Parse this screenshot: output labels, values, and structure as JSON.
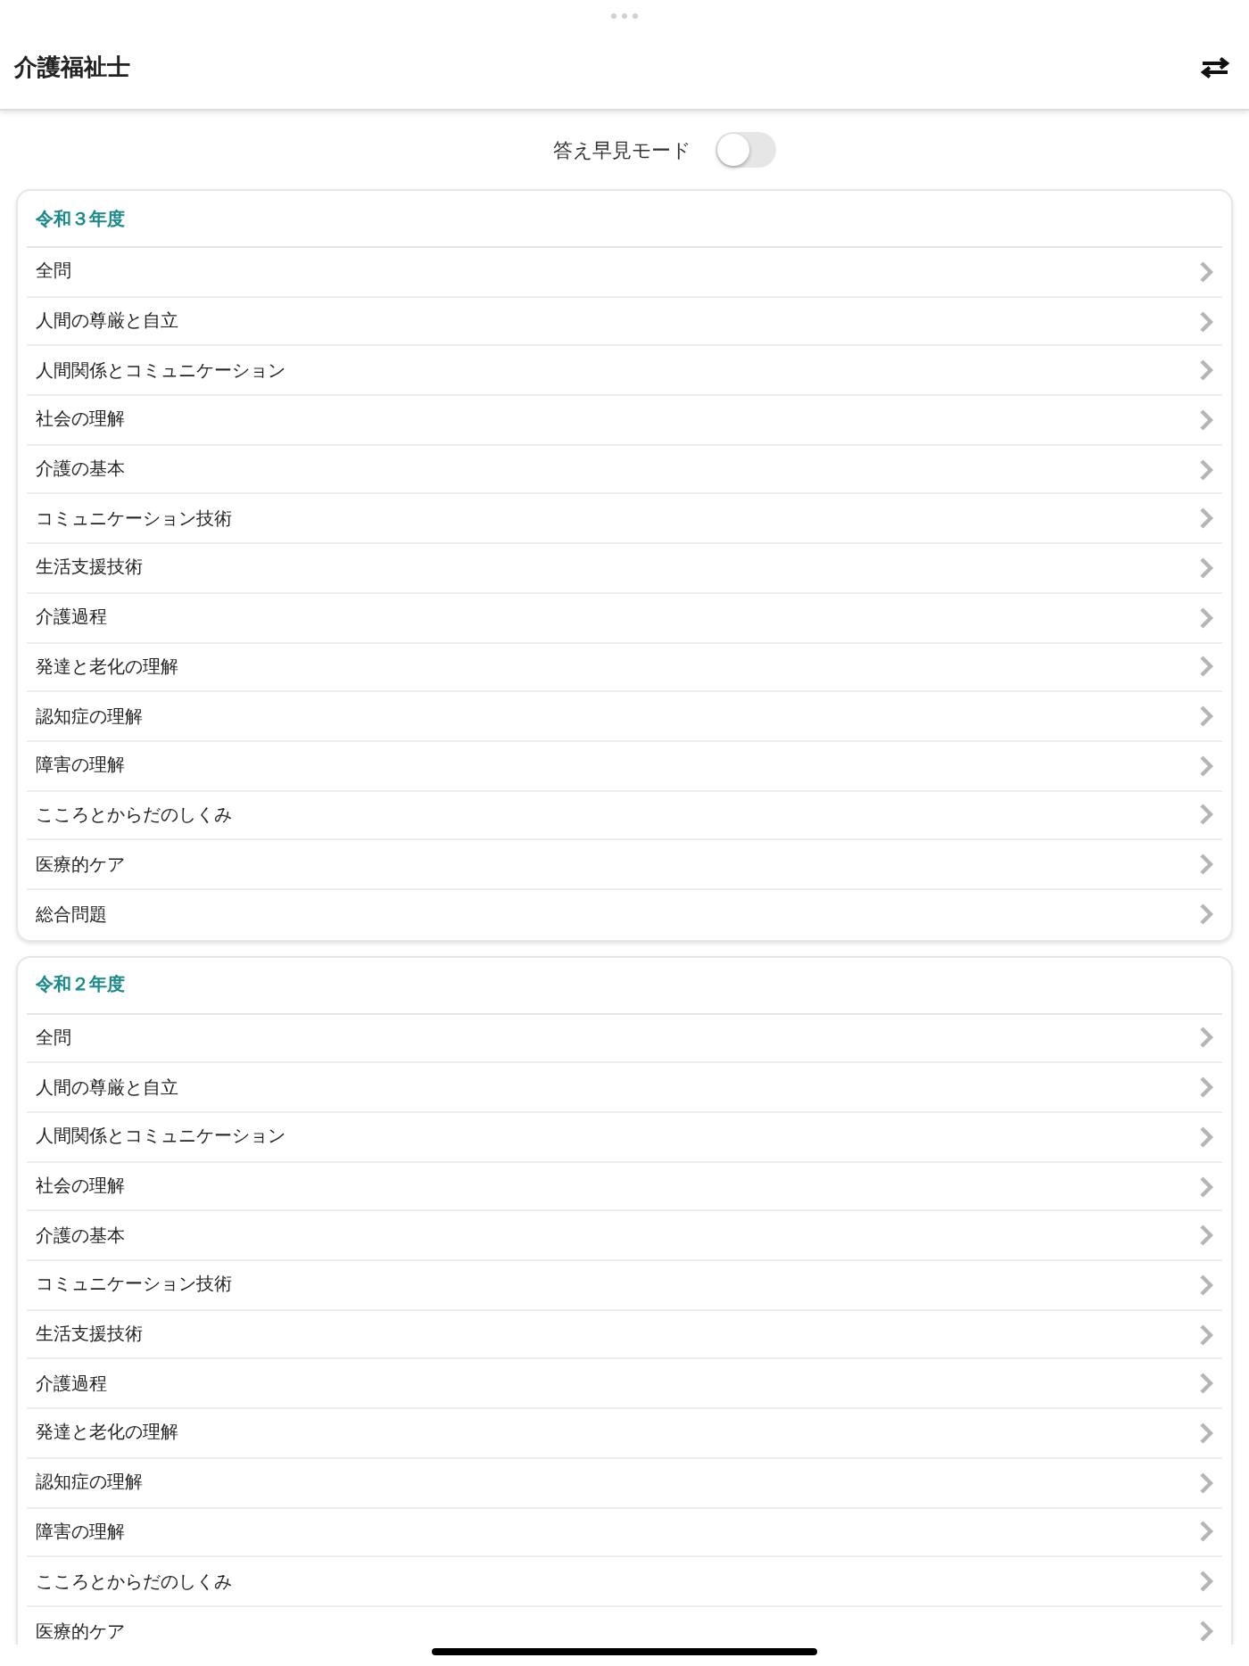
{
  "header": {
    "title": "介護福祉士"
  },
  "answer_preview": {
    "label": "答え早見モード",
    "on": false
  },
  "sections": [
    {
      "title": "令和３年度",
      "items": [
        "全問",
        "人間の尊厳と自立",
        "人間関係とコミュニケーション",
        "社会の理解",
        "介護の基本",
        "コミュニケーション技術",
        "生活支援技術",
        "介護過程",
        "発達と老化の理解",
        "認知症の理解",
        "障害の理解",
        "こころとからだのしくみ",
        "医療的ケア",
        "総合問題"
      ]
    },
    {
      "title": "令和２年度",
      "items": [
        "全問",
        "人間の尊厳と自立",
        "人間関係とコミュニケーション",
        "社会の理解",
        "介護の基本",
        "コミュニケーション技術",
        "生活支援技術",
        "介護過程",
        "発達と老化の理解",
        "認知症の理解",
        "障害の理解",
        "こころとからだのしくみ",
        "医療的ケア"
      ]
    }
  ]
}
